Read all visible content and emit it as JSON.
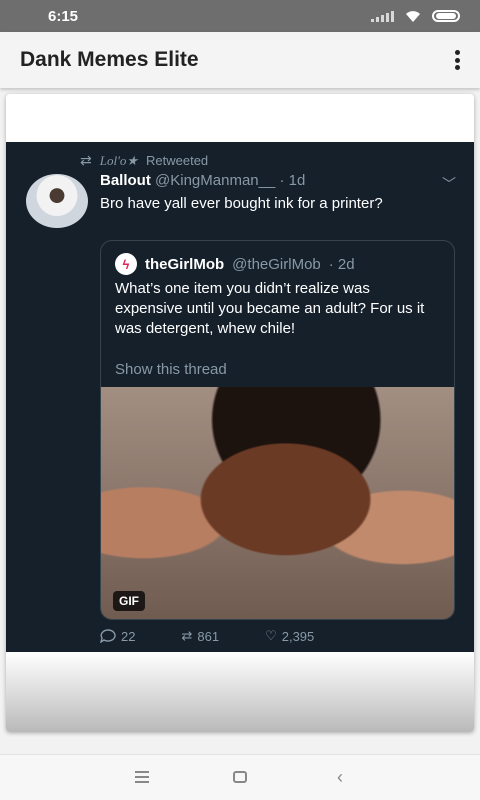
{
  "status_bar": {
    "time": "6:15"
  },
  "app_bar": {
    "title": "Dank Memes Elite",
    "menu_icon": "more-vert-icon"
  },
  "tweet": {
    "retweet_label": "Retweeted",
    "retweeter_name": "Lol'o★",
    "author_name": "Ballout",
    "author_handle": "@KingManman__",
    "author_time": "· 1d",
    "text": "Bro have yall ever bought ink for a printer?",
    "quote": {
      "name": "theGirlMob",
      "handle": "@theGirlMob",
      "time": "· 2d",
      "text": "What’s one item you didn’t realize was expensive until you became an adult? For us it was detergent, whew chile!",
      "show_thread": "Show this thread",
      "gif_badge": "GIF"
    },
    "actions": {
      "replies": "22",
      "retweets": "861",
      "likes": "2,395"
    }
  },
  "colors": {
    "tweet_bg": "#15202b",
    "accent": "#1da1f2",
    "muted": "#8899a6"
  }
}
